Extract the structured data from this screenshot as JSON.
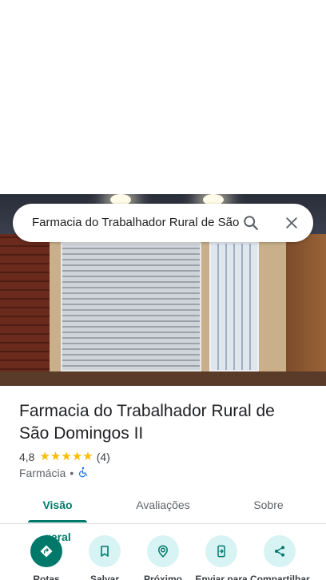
{
  "search": {
    "query": "Farmacia do Trabalhador Rural de São Domingos II"
  },
  "place": {
    "title": "Farmacia do Trabalhador Rural de São Domingos II",
    "rating": "4,8",
    "stars": 5,
    "review_count": "(4)",
    "category": "Farmácia",
    "separator": "•",
    "accessible_icon": "wheelchair-icon"
  },
  "tabs": [
    {
      "label": "Visão geral",
      "active": true
    },
    {
      "label": "Avaliações",
      "active": false
    },
    {
      "label": "Sobre",
      "active": false
    }
  ],
  "actions": [
    {
      "label": "Rotas",
      "icon": "directions-icon"
    },
    {
      "label": "Salvar",
      "icon": "bookmark-icon"
    },
    {
      "label": "Próximo",
      "icon": "nearby-icon"
    },
    {
      "label": "Enviar para",
      "icon": "send-to-phone-icon"
    },
    {
      "label": "Compartilhar",
      "icon": "share-icon"
    }
  ],
  "colors": {
    "accent": "#00796b",
    "action_bg": "#d8f3f4",
    "star": "#fbbc04",
    "accessible": "#1a73e8"
  }
}
